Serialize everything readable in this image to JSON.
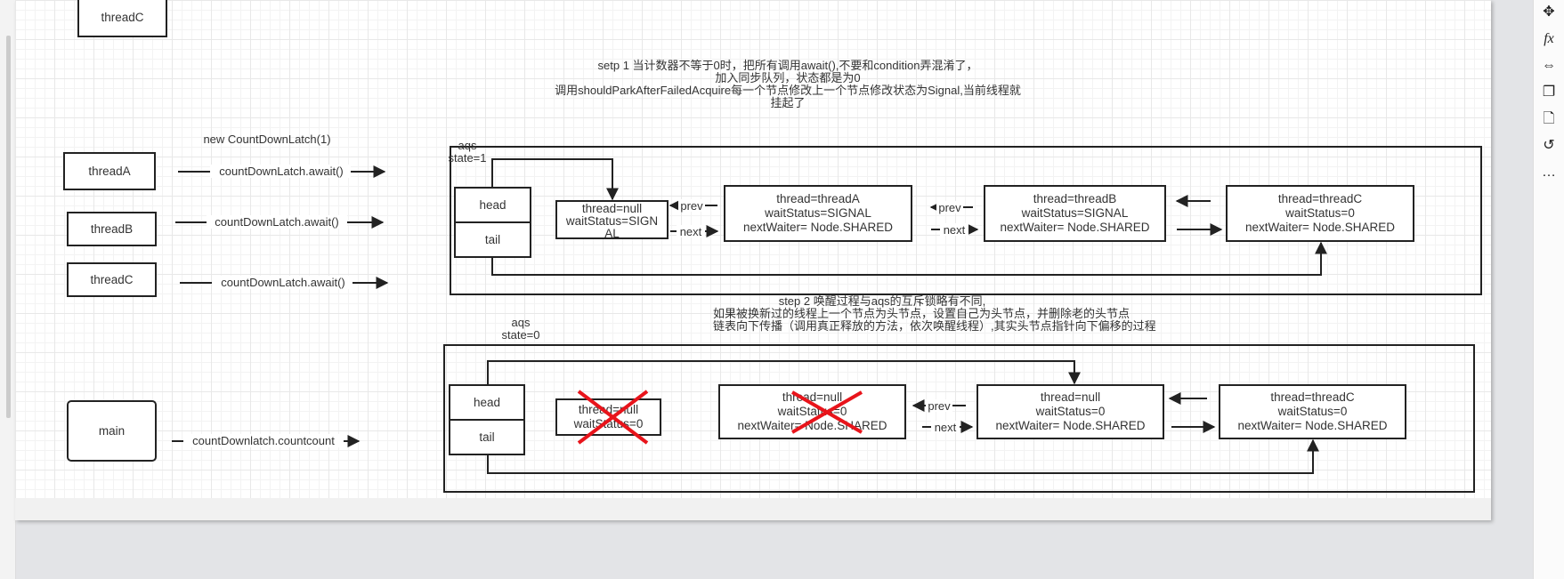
{
  "left_threads": {
    "top_thread": "threadC",
    "threadA": "threadA",
    "threadB": "threadB",
    "threadC": "threadC",
    "main": "main"
  },
  "labels": {
    "new_latch": "new CountDownLatch(1)",
    "await_a": "countDownLatch.await()",
    "await_b": "countDownLatch.await()",
    "await_c": "countDownLatch.await()",
    "countdown": "countDownlatch.countcount"
  },
  "step1": {
    "lines": [
      "setp 1 当计数器不等于0时，把所有调用await(),不要和condition弄混淆了，",
      "加入同步队列，状态都是为0",
      "调用shouldParkAfterFailedAcquire每一个节点修改上一个节点修改状态为Signal,当前线程就",
      "挂起了"
    ],
    "aqs": "aqs",
    "state": "state=1",
    "head": "head",
    "tail": "tail",
    "nodes": [
      [
        "thread=null",
        "waitStatus=SIGN",
        "AL"
      ],
      [
        "thread=threadA",
        "waitStatus=SIGNAL",
        "nextWaiter= Node.SHARED"
      ],
      [
        "thread=threadB",
        "waitStatus=SIGNAL",
        "nextWaiter= Node.SHARED"
      ],
      [
        "thread=threadC",
        "waitStatus=0",
        "nextWaiter= Node.SHARED"
      ]
    ],
    "prev": "prev",
    "next": "next"
  },
  "step2": {
    "lines": [
      "step 2 唤醒过程与aqs的互斥锁略有不同,",
      "如果被换新过的线程上一个节点为头节点，设置自己为头节点，并删除老的头节点",
      "链表向下传播（调用真正释放的方法，依次唤醒线程）,其实头节点指针向下偏移的过程"
    ],
    "aqs": "aqs",
    "state": "state=0",
    "head": "head",
    "tail": "tail",
    "nodes": [
      [
        "thread=null",
        "waitStatus=0"
      ],
      [
        "thread=null",
        "waitStatus=0",
        "nextWaiter= Node.SHARED"
      ],
      [
        "thread=null",
        "waitStatus=0",
        "nextWaiter= Node.SHARED"
      ],
      [
        "thread=threadC",
        "waitStatus=0",
        "nextWaiter= Node.SHARED"
      ]
    ],
    "prev": "prev",
    "next": "next",
    "deleted_color": "#e8141b"
  },
  "toolbar": [
    "navigate-icon",
    "function-icon",
    "resize-icon",
    "copy-icon",
    "page-icon",
    "history-icon",
    "comment-icon"
  ]
}
